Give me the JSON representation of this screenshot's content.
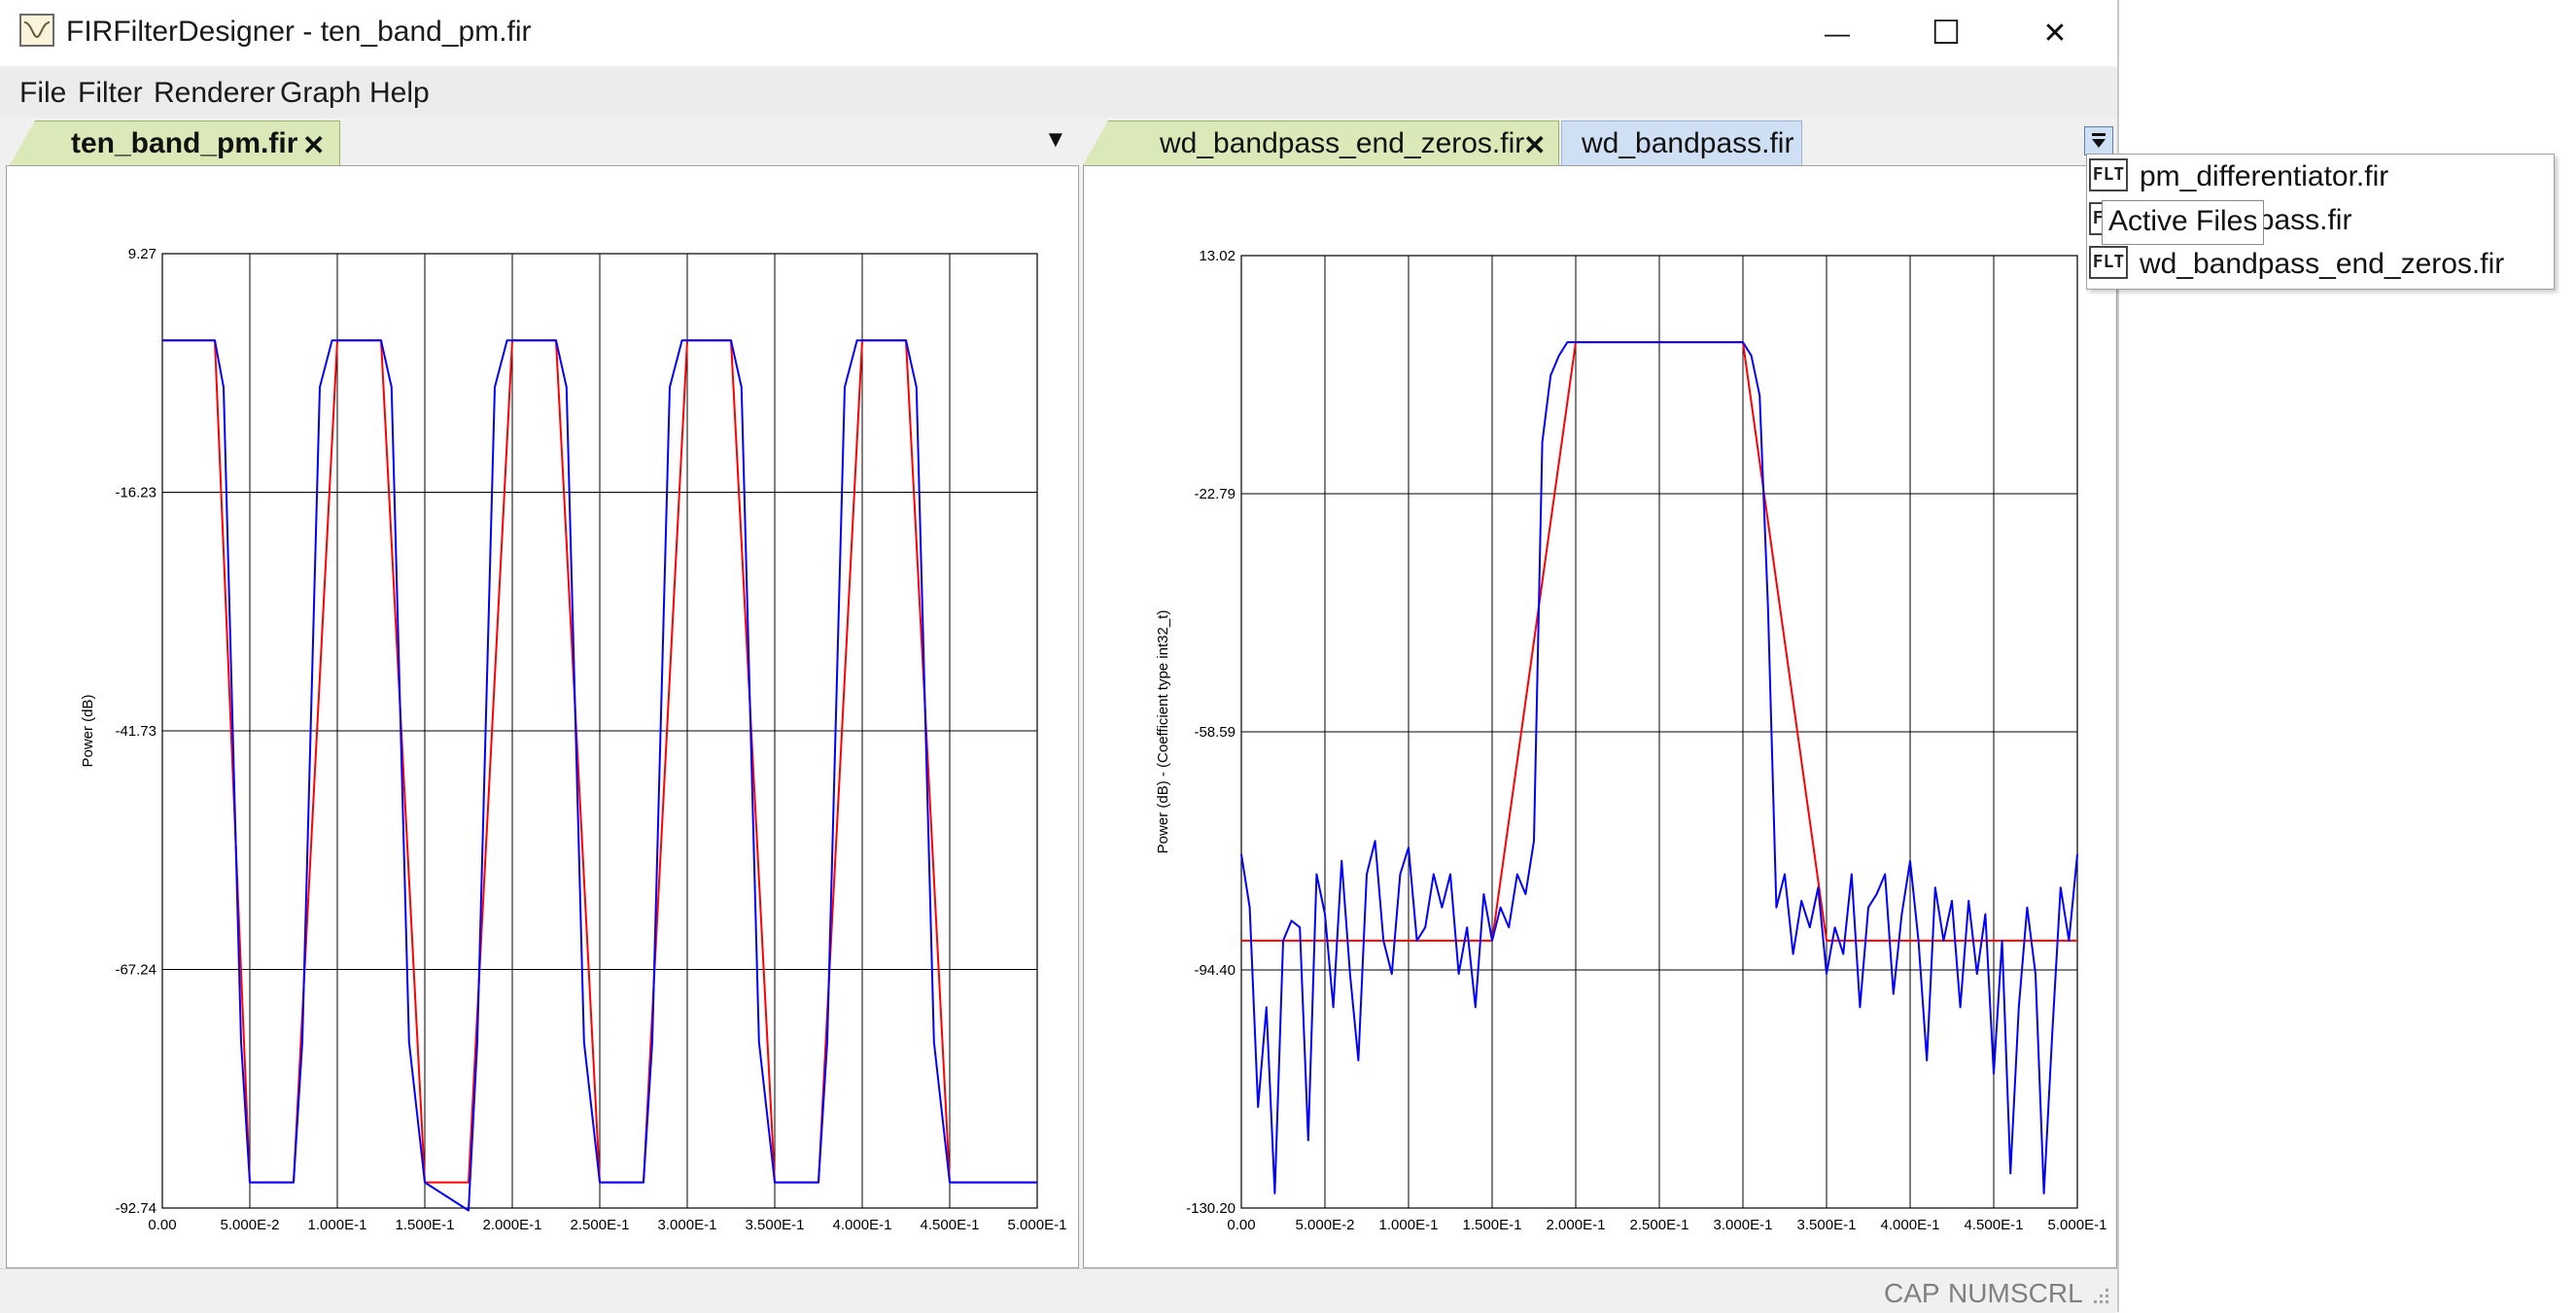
{
  "window": {
    "title": "FIRFilterDesigner - ten_band_pm.fir",
    "minimize_glyph": "—",
    "maximize_glyph": "☐",
    "close_glyph": "✕"
  },
  "menu": [
    "File",
    "Filter",
    "Renderer",
    "Graph",
    "Help"
  ],
  "left_pane": {
    "tabs": [
      {
        "label": "ten_band_pm.fir",
        "active": true,
        "close": "✕"
      }
    ],
    "dropdown_glyph": "▼"
  },
  "right_pane": {
    "tabs": [
      {
        "label": "wd_bandpass_end_zeros.fir",
        "active": true,
        "close": "✕"
      },
      {
        "label": "wd_bandpass.fir",
        "active": false
      }
    ]
  },
  "active_files_menu": {
    "tooltip": "Active Files",
    "items": [
      {
        "icon": "FLT",
        "label": "pm_differentiator.fir"
      },
      {
        "icon": "FLT",
        "label": "wd_bandpass.fir"
      },
      {
        "icon": "FLT",
        "label": "wd_bandpass_end_zeros.fir"
      }
    ]
  },
  "statusbar": {
    "cap": "CAP",
    "num": "NUM",
    "scrl": "SCRL"
  },
  "colors": {
    "response": "#0000ff",
    "target": "#ff0000",
    "active_tab": "#dbe9b9",
    "inactive_tab": "#cfe0f5"
  },
  "chart_data": [
    {
      "type": "line",
      "title": "",
      "xlabel": "",
      "ylabel": "Power (dB)",
      "xlim": [
        0,
        0.5
      ],
      "ylim": [
        -92.74,
        9.27
      ],
      "x_ticks": [
        "0.00",
        "5.000E-2",
        "1.000E-1",
        "1.500E-1",
        "2.000E-1",
        "2.500E-1",
        "3.000E-1",
        "3.500E-1",
        "4.000E-1",
        "4.500E-1",
        "5.000E-1"
      ],
      "y_ticks": [
        "9.27",
        "-16.23",
        "-41.73",
        "-67.24",
        "-92.74"
      ],
      "grid": true,
      "series": [
        {
          "color": "#ff0000",
          "x": [
            0,
            0.03,
            0.05,
            0.075,
            0.1,
            0.125,
            0.15,
            0.175,
            0.2,
            0.225,
            0.25,
            0.275,
            0.3,
            0.325,
            0.35,
            0.375,
            0.4,
            0.425,
            0.45,
            0.5
          ],
          "y": [
            0,
            0,
            -90,
            -90,
            0,
            0,
            -90,
            -90,
            0,
            0,
            -90,
            -90,
            0,
            0,
            -90,
            -90,
            0,
            0,
            -90,
            -90
          ]
        },
        {
          "color": "#0000ff",
          "x": [
            0,
            0.03,
            0.035,
            0.045,
            0.05,
            0.075,
            0.08,
            0.09,
            0.097,
            0.125,
            0.131,
            0.141,
            0.15,
            0.175,
            0.18,
            0.19,
            0.197,
            0.225,
            0.231,
            0.241,
            0.25,
            0.275,
            0.28,
            0.29,
            0.297,
            0.325,
            0.331,
            0.341,
            0.35,
            0.375,
            0.38,
            0.39,
            0.397,
            0.425,
            0.431,
            0.441,
            0.45,
            0.5
          ],
          "y": [
            0,
            0,
            -5,
            -75,
            -90,
            -90,
            -75,
            -5,
            0,
            0,
            -5,
            -75,
            -90,
            -93,
            -75,
            -5,
            0,
            0,
            -5,
            -75,
            -90,
            -90,
            -75,
            -5,
            0,
            0,
            -5,
            -75,
            -90,
            -90,
            -75,
            -5,
            0,
            0,
            -5,
            -75,
            -90,
            -90
          ]
        }
      ]
    },
    {
      "type": "line",
      "title": "",
      "xlabel": "",
      "ylabel": "Power (dB) - (Coefficient type int32_t)",
      "xlim": [
        0,
        0.5
      ],
      "ylim": [
        -130.2,
        13.02
      ],
      "x_ticks": [
        "0.00",
        "5.000E-2",
        "1.000E-1",
        "1.500E-1",
        "2.000E-1",
        "2.500E-1",
        "3.000E-1",
        "3.500E-1",
        "4.000E-1",
        "4.500E-1",
        "5.000E-1"
      ],
      "y_ticks": [
        "13.02",
        "-22.79",
        "-58.59",
        "-94.40",
        "-130.20"
      ],
      "grid": true,
      "series": [
        {
          "color": "#ff0000",
          "x": [
            0,
            0.15,
            0.2,
            0.3,
            0.35,
            0.5
          ],
          "y": [
            -90,
            -90,
            0,
            0,
            -90,
            -90
          ]
        },
        {
          "color": "#0000ff",
          "x": [
            0,
            0.005,
            0.01,
            0.015,
            0.02,
            0.025,
            0.03,
            0.035,
            0.04,
            0.045,
            0.05,
            0.055,
            0.06,
            0.065,
            0.07,
            0.075,
            0.08,
            0.085,
            0.09,
            0.095,
            0.1,
            0.105,
            0.11,
            0.115,
            0.12,
            0.125,
            0.13,
            0.135,
            0.14,
            0.145,
            0.15,
            0.155,
            0.16,
            0.165,
            0.17,
            0.175,
            0.18,
            0.185,
            0.19,
            0.195,
            0.2,
            0.25,
            0.3,
            0.305,
            0.31,
            0.315,
            0.32,
            0.325,
            0.33,
            0.335,
            0.34,
            0.345,
            0.35,
            0.355,
            0.36,
            0.365,
            0.37,
            0.375,
            0.38,
            0.385,
            0.39,
            0.395,
            0.4,
            0.405,
            0.41,
            0.415,
            0.42,
            0.425,
            0.43,
            0.435,
            0.44,
            0.445,
            0.45,
            0.455,
            0.46,
            0.465,
            0.47,
            0.475,
            0.48,
            0.485,
            0.49,
            0.495,
            0.5
          ],
          "y": [
            -77,
            -85,
            -115,
            -100,
            -128,
            -90,
            -87,
            -88,
            -120,
            -80,
            -86,
            -100,
            -78,
            -95,
            -108,
            -80,
            -75,
            -90,
            -95,
            -80,
            -76,
            -90,
            -88,
            -80,
            -85,
            -80,
            -95,
            -88,
            -100,
            -83,
            -90,
            -85,
            -88,
            -80,
            -83,
            -75,
            -15,
            -5,
            -2,
            0,
            0,
            0,
            0,
            -2,
            -8,
            -40,
            -85,
            -80,
            -92,
            -84,
            -88,
            -82,
            -95,
            -88,
            -92,
            -80,
            -100,
            -85,
            -83,
            -80,
            -98,
            -86,
            -78,
            -90,
            -108,
            -82,
            -90,
            -84,
            -100,
            -84,
            -95,
            -86,
            -110,
            -90,
            -125,
            -100,
            -85,
            -95,
            -128,
            -104,
            -82,
            -90,
            -77
          ]
        }
      ]
    }
  ]
}
